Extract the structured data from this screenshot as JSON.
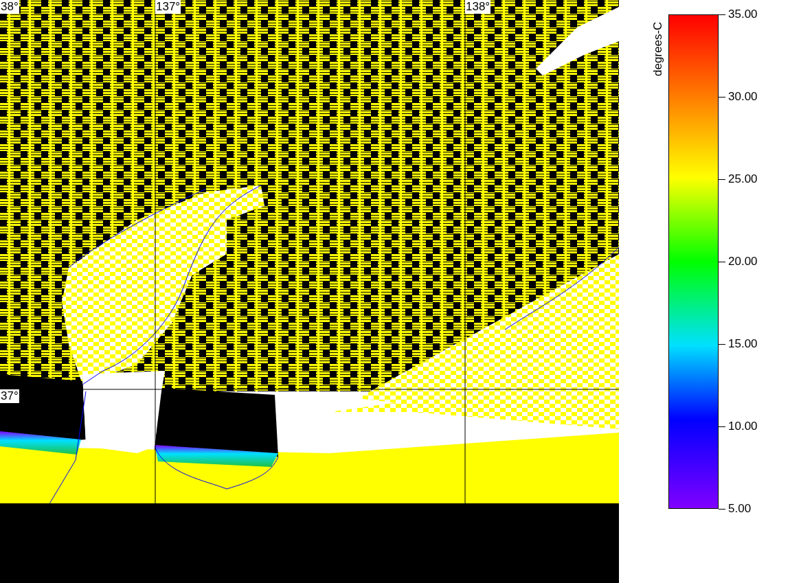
{
  "map": {
    "grid_labels": [
      "38°",
      "137°",
      "138°",
      "37°"
    ]
  },
  "colorbar": {
    "title": "degrees-C",
    "ticks": [
      "35.00",
      "30.00",
      "25.00",
      "20.00",
      "15.00",
      "10.00",
      "5.00"
    ]
  }
}
